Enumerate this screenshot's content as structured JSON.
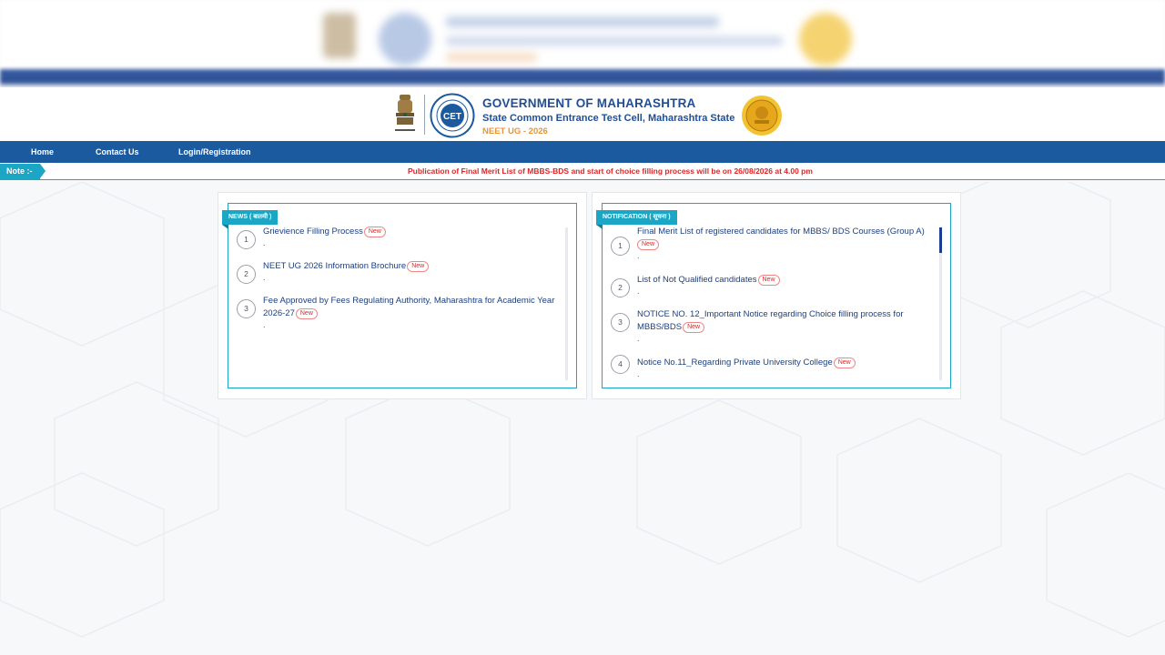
{
  "header": {
    "title": "GOVERNMENT OF MAHARASHTRA",
    "subtitle": "State Common Entrance Test Cell, Maharashtra State",
    "exam": "NEET UG - 2026"
  },
  "nav": {
    "items": [
      {
        "label": "Home"
      },
      {
        "label": "Contact Us"
      },
      {
        "label": "Login/Registration"
      }
    ]
  },
  "note": {
    "label": "Note :-",
    "text": "Publication of Final Merit List of MBBS-BDS and start of choice filling process will be on 26/08/2026 at 4.00 pm"
  },
  "news": {
    "tag": "NEWS ( बातमी )",
    "items": [
      {
        "num": "1",
        "title": "Grievience Filling Process",
        "badge": "New",
        "sub": "."
      },
      {
        "num": "2",
        "title": "NEET UG 2026 Information Brochure",
        "badge": "New",
        "sub": "."
      },
      {
        "num": "3",
        "title": "Fee Approved by Fees Regulating Authority, Maharashtra for Academic Year 2026-27",
        "badge": "New",
        "sub": "."
      }
    ]
  },
  "notification": {
    "tag": "NOTIFICATION ( सूचना )",
    "items": [
      {
        "num": "1",
        "title": "Final Merit List of registered candidates for MBBS/ BDS Courses (Group A)",
        "badge": "New",
        "sub": "."
      },
      {
        "num": "2",
        "title": "List of Not Qualified candidates",
        "badge": "New",
        "sub": "."
      },
      {
        "num": "3",
        "title": "NOTICE NO. 12_Important Notice regarding Choice filling process for MBBS/BDS",
        "badge": "New",
        "sub": "."
      },
      {
        "num": "4",
        "title": "Notice No.11_Regarding Private University College",
        "badge": "New",
        "sub": "."
      }
    ]
  },
  "colors": {
    "nav_bg": "#1c5aa0",
    "accent_teal": "#1aa6c4",
    "title_blue": "#1f4e96",
    "exam_orange": "#e8953a",
    "alert_red": "#e02424"
  }
}
